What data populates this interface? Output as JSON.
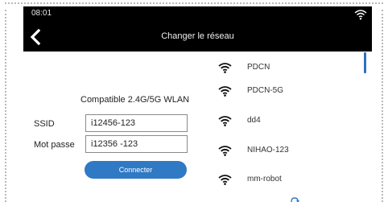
{
  "status_bar": {
    "time": "08:01"
  },
  "header": {
    "title": "Changer le réseau",
    "back_icon": "chevron-left-icon"
  },
  "form": {
    "compatibility_text": "Compatible 2.4G/5G WLAN",
    "ssid_label": "SSID",
    "ssid_value": "i12456-123",
    "password_label": "Mot passe",
    "password_value": "i12356 -123",
    "connect_label": "Connecter"
  },
  "networks": [
    {
      "name": "PDCN",
      "icon": "wifi-icon"
    },
    {
      "name": "PDCN-5G",
      "icon": "wifi-icon"
    },
    {
      "name": "dd4",
      "icon": "wifi-icon"
    },
    {
      "name": "NIHAO-123",
      "icon": "wifi-icon"
    },
    {
      "name": "mm-robot",
      "icon": "wifi-icon"
    }
  ],
  "colors": {
    "accent": "#2f79c5",
    "bar_background": "#000000",
    "scrollbar": "#2f6fc0"
  }
}
